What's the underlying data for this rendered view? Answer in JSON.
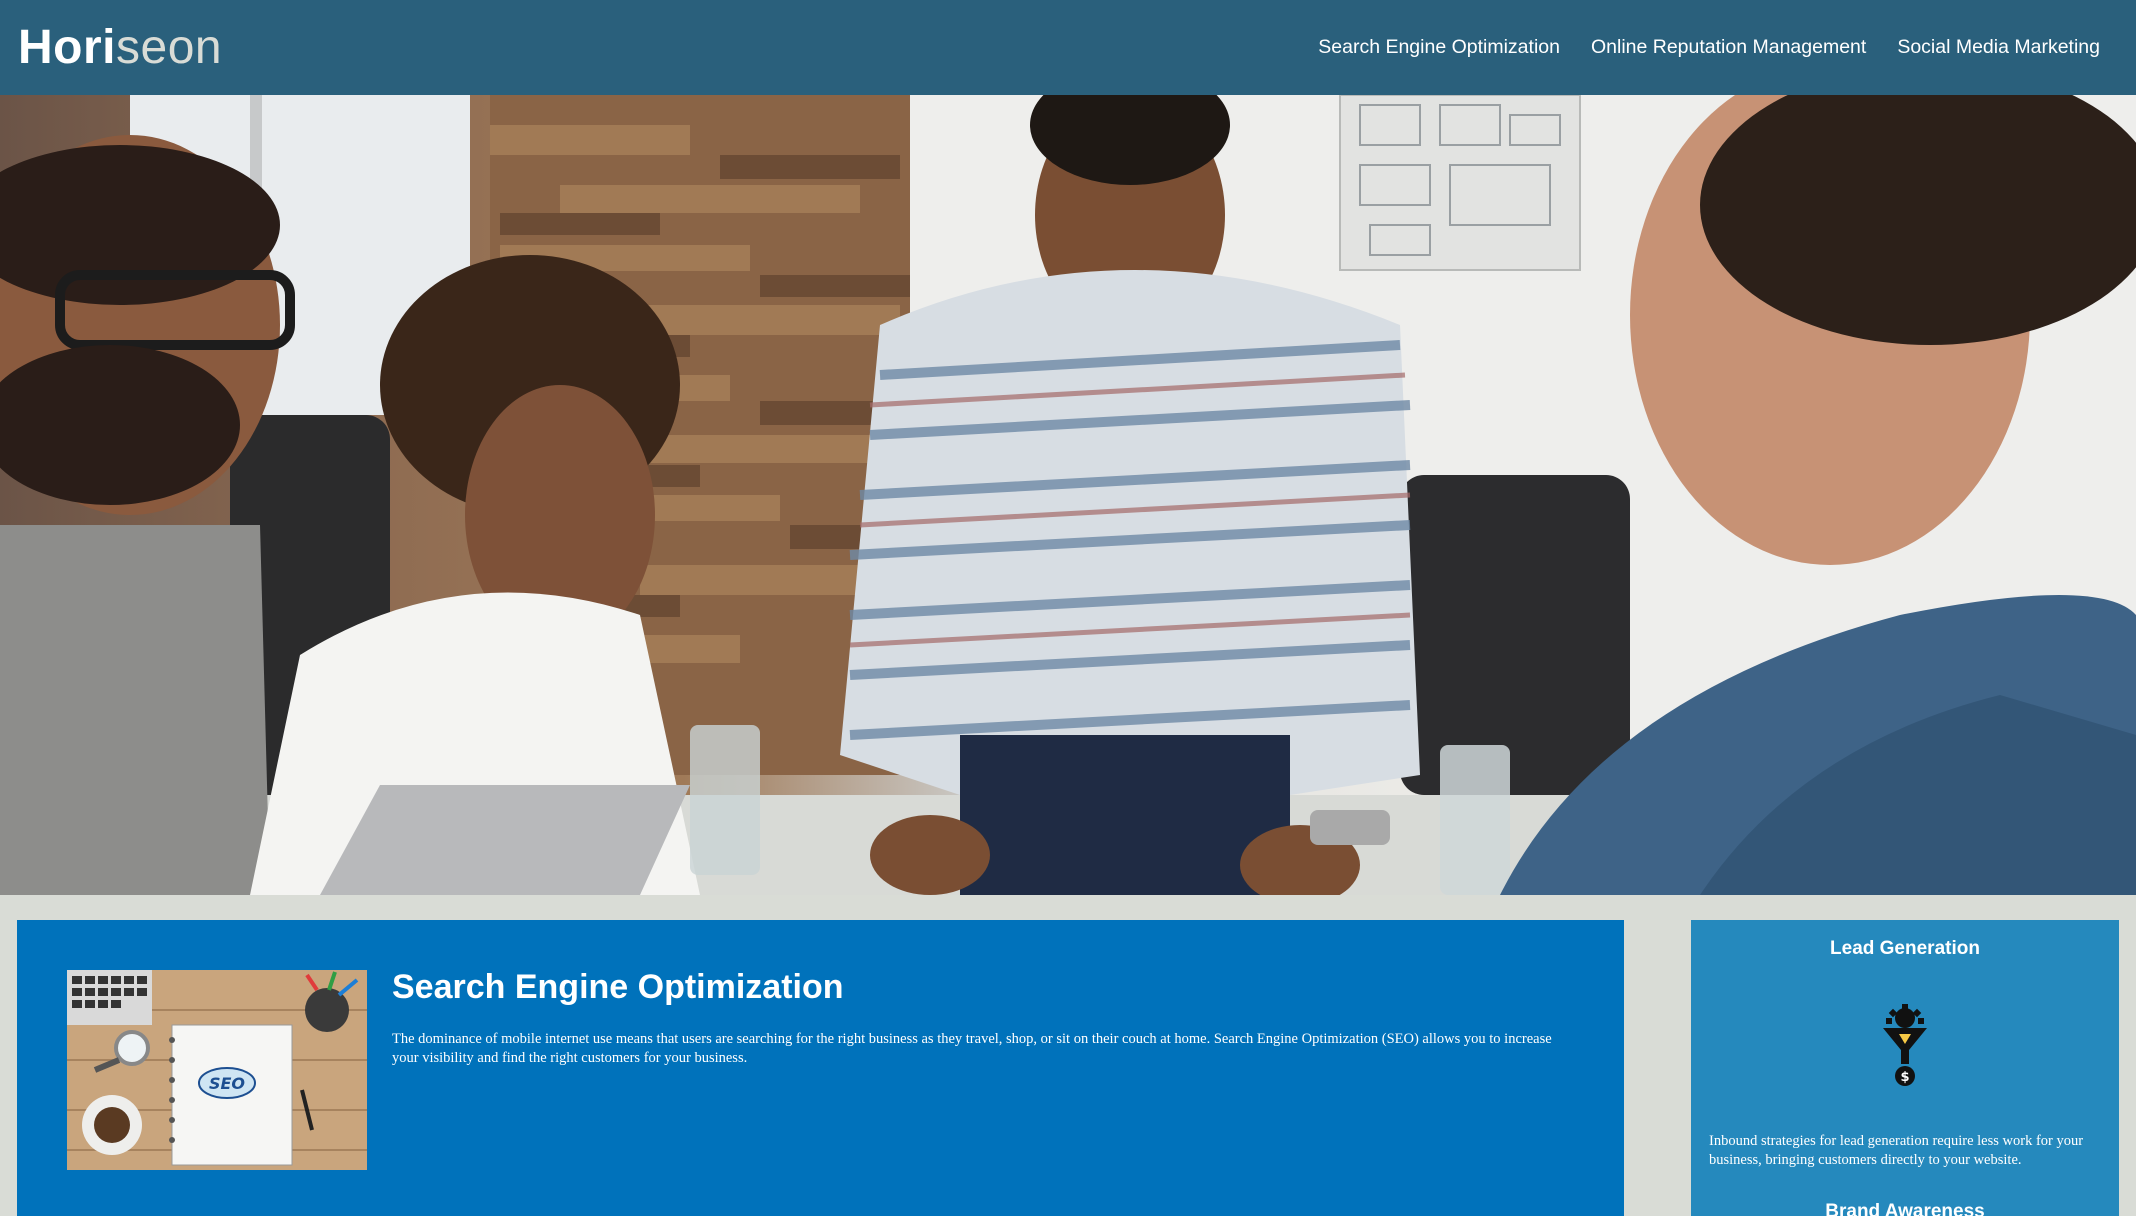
{
  "header": {
    "logo_main": "Hori",
    "logo_accent": "seon",
    "nav": [
      {
        "label": "Search Engine Optimization"
      },
      {
        "label": "Online Reputation Management"
      },
      {
        "label": "Social Media Marketing"
      }
    ]
  },
  "hero": {
    "image": "team-meeting-photo"
  },
  "content": {
    "title": "Search Engine Optimization",
    "body": "The dominance of mobile internet use means that users are searching for the right business as they travel, shop, or sit on their couch at home. Search Engine Optimization (SEO) allows you to increase your visibility and find the right customers for your business.",
    "thumb_text": "SEO"
  },
  "sidebar": {
    "sections": [
      {
        "title": "Lead Generation",
        "icon": "lead-generation-funnel-icon",
        "body": "Inbound strategies for lead generation require less work for your business, bringing customers directly to your website."
      },
      {
        "title": "Brand Awareness"
      }
    ]
  },
  "colors": {
    "header_bg": "#2a607c",
    "page_bg": "#d9dcd6",
    "content_bg": "#0072bb",
    "sidebar_bg": "#2589bd"
  }
}
